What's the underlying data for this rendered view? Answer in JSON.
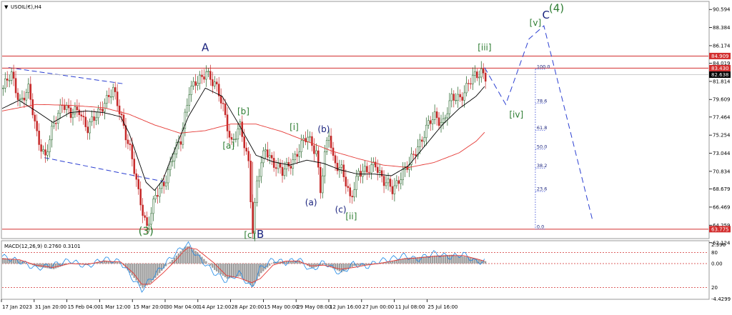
{
  "window": {
    "symbol_title": "USOIL(€),H4",
    "arrow_glyph": "▼"
  },
  "chart_data": {
    "type": "candlestick",
    "title": "USOIL(€),H4",
    "price_axis": {
      "ylim": [
        62.8,
        91.4
      ],
      "ticks": [
        "90.594",
        "88.384",
        "86.174",
        "84.019",
        "81.814",
        "79.609",
        "77.464",
        "75.254",
        "73.044",
        "70.834",
        "68.679",
        "66.469",
        "64.259",
        "62.124"
      ]
    },
    "x_labels": [
      "17 Jan 2023",
      "31 Jan 20:00",
      "15 Feb 04:00",
      "1 Mar 12:00",
      "15 Mar 20:00",
      "30 Mar 04:00",
      "14 Apr 12:00",
      "28 Apr 20:00",
      "15 May 00:00",
      "29 May 08:00",
      "12 Jun 16:00",
      "27 Jun 00:00",
      "11 Jul 08:00",
      "25 Jul 16:00"
    ],
    "price_path": [
      [
        0,
        81.0
      ],
      [
        4,
        82.5
      ],
      [
        8,
        79.5
      ],
      [
        12,
        80.6
      ],
      [
        16,
        75.5
      ],
      [
        20,
        72.5
      ],
      [
        24,
        76.5
      ],
      [
        28,
        79.5
      ],
      [
        32,
        77.5
      ],
      [
        36,
        78.5
      ],
      [
        40,
        76.0
      ],
      [
        44,
        77.5
      ],
      [
        48,
        79.5
      ],
      [
        52,
        80.5
      ],
      [
        56,
        77.5
      ],
      [
        60,
        73.5
      ],
      [
        64,
        68.0
      ],
      [
        68,
        64.2
      ],
      [
        72,
        67.5
      ],
      [
        76,
        69.5
      ],
      [
        80,
        72.5
      ],
      [
        84,
        74.5
      ],
      [
        88,
        81.0
      ],
      [
        92,
        81.6
      ],
      [
        94,
        82.0
      ],
      [
        96,
        83.3
      ],
      [
        100,
        81.5
      ],
      [
        104,
        78.5
      ],
      [
        108,
        74.5
      ],
      [
        112,
        76.0
      ],
      [
        116,
        72.0
      ],
      [
        118,
        63.8
      ],
      [
        120,
        69.5
      ],
      [
        124,
        73.5
      ],
      [
        128,
        72.0
      ],
      [
        132,
        70.5
      ],
      [
        136,
        72.0
      ],
      [
        140,
        73.5
      ],
      [
        144,
        75.0
      ],
      [
        148,
        73.5
      ],
      [
        150,
        68.4
      ],
      [
        152,
        72.5
      ],
      [
        154,
        75.5
      ],
      [
        156,
        72.5
      ],
      [
        160,
        71.0
      ],
      [
        164,
        67.3
      ],
      [
        168,
        71.0
      ],
      [
        172,
        70.5
      ],
      [
        176,
        72.0
      ],
      [
        180,
        69.5
      ],
      [
        184,
        68.5
      ],
      [
        188,
        70.5
      ],
      [
        192,
        71.5
      ],
      [
        196,
        74.0
      ],
      [
        200,
        76.0
      ],
      [
        204,
        77.5
      ],
      [
        208,
        77.0
      ],
      [
        212,
        79.5
      ],
      [
        216,
        80.0
      ],
      [
        220,
        81.5
      ],
      [
        224,
        82.5
      ],
      [
        226,
        83.2
      ],
      [
        228,
        82.6
      ]
    ],
    "sma_fast": [
      [
        0,
        78.5
      ],
      [
        8,
        79.5
      ],
      [
        16,
        78.2
      ],
      [
        24,
        76.8
      ],
      [
        32,
        78.0
      ],
      [
        40,
        78.2
      ],
      [
        48,
        78.0
      ],
      [
        56,
        77.5
      ],
      [
        60,
        75.5
      ],
      [
        64,
        72.5
      ],
      [
        68,
        69.5
      ],
      [
        72,
        68.5
      ],
      [
        76,
        69.8
      ],
      [
        80,
        72.5
      ],
      [
        88,
        77.5
      ],
      [
        96,
        81.0
      ],
      [
        104,
        80.0
      ],
      [
        112,
        76.5
      ],
      [
        120,
        72.8
      ],
      [
        128,
        72.0
      ],
      [
        136,
        71.6
      ],
      [
        144,
        72.2
      ],
      [
        152,
        71.8
      ],
      [
        160,
        71.0
      ],
      [
        168,
        70.5
      ],
      [
        176,
        70.5
      ],
      [
        184,
        70.3
      ],
      [
        192,
        71.5
      ],
      [
        200,
        74.0
      ],
      [
        208,
        76.5
      ],
      [
        216,
        78.5
      ],
      [
        224,
        80.0
      ],
      [
        228,
        81.2
      ]
    ],
    "sma_slow": [
      [
        0,
        78.2
      ],
      [
        16,
        79.0
      ],
      [
        32,
        78.9
      ],
      [
        48,
        78.6
      ],
      [
        60,
        77.8
      ],
      [
        72,
        76.5
      ],
      [
        84,
        75.5
      ],
      [
        96,
        75.8
      ],
      [
        108,
        76.6
      ],
      [
        120,
        76.6
      ],
      [
        132,
        75.7
      ],
      [
        144,
        74.5
      ],
      [
        156,
        73.3
      ],
      [
        168,
        72.4
      ],
      [
        180,
        71.6
      ],
      [
        192,
        71.3
      ],
      [
        204,
        71.9
      ],
      [
        216,
        73.1
      ],
      [
        224,
        74.5
      ],
      [
        228,
        75.6
      ]
    ],
    "projection_path": [
      [
        228,
        83.5
      ],
      [
        238,
        79.0
      ],
      [
        249,
        87.0
      ],
      [
        256,
        88.6
      ],
      [
        279,
        64.9
      ]
    ],
    "channel_lines": [
      {
        "name": "upper",
        "points": [
          [
            3,
            83.5
          ],
          [
            58,
            81.5
          ]
        ]
      },
      {
        "name": "lower",
        "points": [
          [
            20,
            72.5
          ],
          [
            78,
            69.5
          ]
        ]
      }
    ],
    "horizontal_levels": [
      {
        "value": 84.909,
        "label": "84.909",
        "color": "#d32f2f"
      },
      {
        "value": 83.43,
        "label": "83.430",
        "color": "#d32f2f"
      },
      {
        "value": 82.638,
        "label": "82.638",
        "color": "#000000"
      },
      {
        "value": 63.775,
        "label": "63.775",
        "color": "#d32f2f"
      }
    ],
    "fib_retracement": {
      "x": 252,
      "range": [
        63.775,
        83.3
      ],
      "levels": [
        {
          "ratio": 1.0,
          "label": "100.0"
        },
        {
          "ratio": 0.786,
          "label": "78.6"
        },
        {
          "ratio": 0.618,
          "label": "61.8"
        },
        {
          "ratio": 0.5,
          "label": "50.0"
        },
        {
          "ratio": 0.382,
          "label": "38.2"
        },
        {
          "ratio": 0.236,
          "label": "23.6"
        },
        {
          "ratio": 0.0,
          "label": "0.0"
        }
      ]
    },
    "wave_labels": [
      {
        "text": "A",
        "x": 96,
        "price": 85.5,
        "color": "#1a237e",
        "size": "large"
      },
      {
        "text": "(3)",
        "x": 68,
        "price": 63.1,
        "color": "#2e7d32",
        "size": "large"
      },
      {
        "text": "[c]",
        "x": 117,
        "price": 62.7,
        "color": "#2e7d32",
        "size": "medium"
      },
      {
        "text": "B",
        "x": 122,
        "price": 62.7,
        "color": "#1a237e",
        "size": "large"
      },
      {
        "text": "[b]",
        "x": 114,
        "price": 77.8,
        "color": "#2e7d32",
        "size": "medium"
      },
      {
        "text": "[a]",
        "x": 107,
        "price": 73.6,
        "color": "#2e7d32",
        "size": "medium"
      },
      {
        "text": "[i]",
        "x": 138,
        "price": 75.9,
        "color": "#2e7d32",
        "size": "medium"
      },
      {
        "text": "(b)",
        "x": 152,
        "price": 75.6,
        "color": "#1a237e",
        "size": "medium"
      },
      {
        "text": "(a)",
        "x": 146,
        "price": 66.7,
        "color": "#1a237e",
        "size": "medium"
      },
      {
        "text": "(c)",
        "x": 160,
        "price": 65.8,
        "color": "#1a237e",
        "size": "medium"
      },
      {
        "text": "[ii]",
        "x": 165,
        "price": 65.0,
        "color": "#2e7d32",
        "size": "medium"
      },
      {
        "text": "[iii]",
        "x": 228,
        "price": 85.6,
        "color": "#2e7d32",
        "size": "medium"
      },
      {
        "text": "[iv]",
        "x": 243,
        "price": 77.4,
        "color": "#2e7d32",
        "size": "medium"
      },
      {
        "text": "[v]",
        "x": 252,
        "price": 88.6,
        "color": "#2e7d32",
        "size": "medium"
      },
      {
        "text": "C",
        "x": 257,
        "price": 89.5,
        "color": "#1a237e",
        "size": "large"
      },
      {
        "text": "(4)",
        "x": 262,
        "price": 90.3,
        "color": "#2e7d32",
        "size": "large"
      }
    ],
    "macd": {
      "label": "MACD(12,26,9) 0.2760 0.3101",
      "ylim": [
        -4.4,
        2.6
      ],
      "ticks": [
        "2.396",
        "80",
        "0.00",
        "20",
        "-4.4299"
      ],
      "histogram": [
        [
          0,
          0.7
        ],
        [
          8,
          0.4
        ],
        [
          16,
          -0.4
        ],
        [
          24,
          -0.7
        ],
        [
          32,
          0.1
        ],
        [
          40,
          -0.2
        ],
        [
          48,
          0.4
        ],
        [
          56,
          0.1
        ],
        [
          62,
          -1.8
        ],
        [
          66,
          -3.1
        ],
        [
          70,
          -2.4
        ],
        [
          76,
          -0.6
        ],
        [
          82,
          1.0
        ],
        [
          86,
          2.1
        ],
        [
          88,
          2.2
        ],
        [
          92,
          1.4
        ],
        [
          100,
          -0.8
        ],
        [
          106,
          -1.9
        ],
        [
          112,
          -1.6
        ],
        [
          118,
          -2.9
        ],
        [
          122,
          -1.2
        ],
        [
          128,
          0.2
        ],
        [
          134,
          0.3
        ],
        [
          140,
          0.4
        ],
        [
          146,
          -0.6
        ],
        [
          152,
          -0.1
        ],
        [
          160,
          -1.1
        ],
        [
          166,
          -0.3
        ],
        [
          172,
          -0.2
        ],
        [
          178,
          0.1
        ],
        [
          184,
          0.3
        ],
        [
          190,
          0.7
        ],
        [
          196,
          0.8
        ],
        [
          204,
          1.0
        ],
        [
          212,
          1.1
        ],
        [
          218,
          0.9
        ],
        [
          224,
          0.6
        ],
        [
          228,
          0.3
        ]
      ],
      "macd_line": [
        [
          0,
          0.9
        ],
        [
          8,
          0.3
        ],
        [
          16,
          -0.6
        ],
        [
          24,
          -0.2
        ],
        [
          32,
          0.4
        ],
        [
          40,
          -0.4
        ],
        [
          48,
          0.6
        ],
        [
          56,
          0.2
        ],
        [
          62,
          -2.0
        ],
        [
          66,
          -3.3
        ],
        [
          70,
          -2.0
        ],
        [
          76,
          -0.3
        ],
        [
          82,
          1.3
        ],
        [
          86,
          2.2
        ],
        [
          88,
          2.4
        ],
        [
          92,
          1.0
        ],
        [
          100,
          -1.1
        ],
        [
          106,
          -2.2
        ],
        [
          112,
          -1.2
        ],
        [
          118,
          -3.1
        ],
        [
          122,
          -0.6
        ],
        [
          128,
          0.5
        ],
        [
          134,
          0.1
        ],
        [
          140,
          0.6
        ],
        [
          146,
          -0.9
        ],
        [
          152,
          0.2
        ],
        [
          160,
          -1.3
        ],
        [
          166,
          0.0
        ],
        [
          172,
          -0.4
        ],
        [
          178,
          0.3
        ],
        [
          184,
          0.6
        ],
        [
          190,
          1.0
        ],
        [
          196,
          0.5
        ],
        [
          204,
          1.3
        ],
        [
          212,
          0.8
        ],
        [
          218,
          1.2
        ],
        [
          224,
          0.2
        ],
        [
          228,
          0.28
        ]
      ],
      "signal_line": [
        [
          0,
          0.6
        ],
        [
          8,
          0.5
        ],
        [
          16,
          -0.2
        ],
        [
          24,
          -0.5
        ],
        [
          32,
          0.0
        ],
        [
          40,
          -0.1
        ],
        [
          48,
          0.3
        ],
        [
          56,
          0.2
        ],
        [
          62,
          -1.2
        ],
        [
          66,
          -2.6
        ],
        [
          70,
          -2.6
        ],
        [
          76,
          -1.2
        ],
        [
          82,
          0.4
        ],
        [
          86,
          1.6
        ],
        [
          88,
          2.0
        ],
        [
          92,
          1.8
        ],
        [
          100,
          0.1
        ],
        [
          106,
          -1.5
        ],
        [
          112,
          -1.8
        ],
        [
          118,
          -2.4
        ],
        [
          122,
          -1.9
        ],
        [
          128,
          -0.2
        ],
        [
          134,
          0.3
        ],
        [
          140,
          0.3
        ],
        [
          146,
          -0.3
        ],
        [
          152,
          -0.2
        ],
        [
          160,
          -0.7
        ],
        [
          166,
          -0.5
        ],
        [
          172,
          -0.2
        ],
        [
          178,
          0.0
        ],
        [
          184,
          0.3
        ],
        [
          190,
          0.6
        ],
        [
          196,
          0.7
        ],
        [
          204,
          0.9
        ],
        [
          212,
          1.0
        ],
        [
          218,
          1.0
        ],
        [
          224,
          0.6
        ],
        [
          228,
          0.31
        ]
      ],
      "levels": [
        {
          "value": 1.4,
          "color": "#d32f2f"
        },
        {
          "value": 0.0,
          "color": "#d32f2f"
        },
        {
          "value": -3.0,
          "color": "#d32f2f"
        }
      ]
    }
  },
  "colors": {
    "candle_up": "#1b5e20",
    "candle_down": "#c62828",
    "sma_fast": "#000000",
    "sma_slow": "#e53935",
    "projection": "#2b3fd1",
    "channel": "#2b3fd1",
    "macd_hist": "#9e9e9e",
    "macd_line": "#1e88e5",
    "signal_line": "#e53935",
    "fib": "#2b3fd1",
    "grid": "#c8c8c8"
  }
}
